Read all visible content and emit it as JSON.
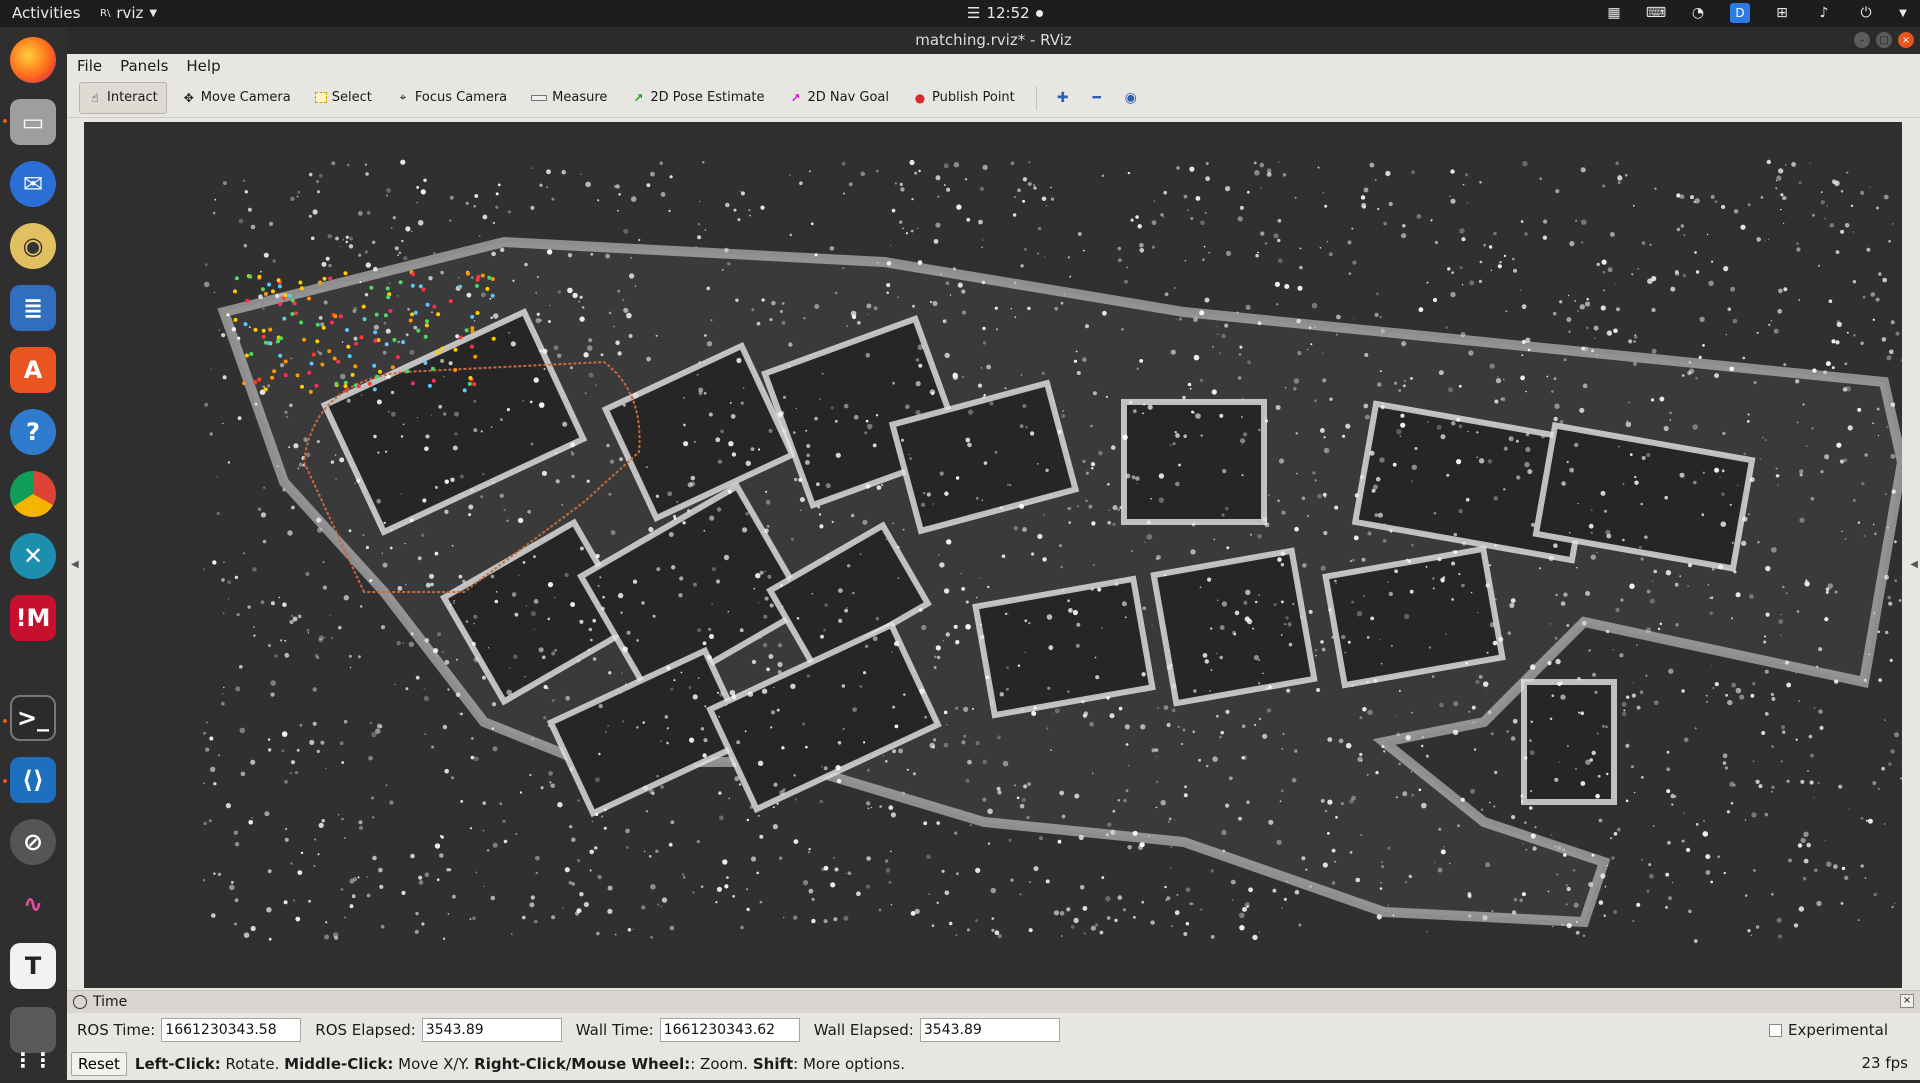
{
  "topbar": {
    "activities": "Activities",
    "app_name": "rviz",
    "time": "12:52"
  },
  "window": {
    "title": "matching.rviz* - RViz"
  },
  "menu": {
    "file": "File",
    "panels": "Panels",
    "help": "Help"
  },
  "toolbar": {
    "interact": "Interact",
    "move_camera": "Move Camera",
    "select": "Select",
    "focus_camera": "Focus Camera",
    "measure": "Measure",
    "pose_estimate": "2D Pose Estimate",
    "nav_goal": "2D Nav Goal",
    "publish_point": "Publish Point"
  },
  "time_panel": {
    "title": "Time",
    "ros_time_label": "ROS Time:",
    "ros_time_value": "1661230343.58",
    "ros_elapsed_label": "ROS Elapsed:",
    "ros_elapsed_value": "3543.89",
    "wall_time_label": "Wall Time:",
    "wall_time_value": "1661230343.62",
    "wall_elapsed_label": "Wall Elapsed:",
    "wall_elapsed_value": "3543.89",
    "experimental_label": "Experimental"
  },
  "status": {
    "reset": "Reset",
    "left_click": "Left-Click:",
    "left_click_action": " Rotate. ",
    "middle_click": "Middle-Click:",
    "middle_click_action": " Move X/Y. ",
    "right_click": "Right-Click/Mouse Wheel:",
    "right_click_action": ": Zoom. ",
    "shift": "Shift",
    "shift_action": ": More options.",
    "fps": "23 fps"
  },
  "colors": {
    "viewport_bg": "#303030",
    "point_cloud": "#ffffff",
    "ubuntu_orange": "#e95420"
  }
}
